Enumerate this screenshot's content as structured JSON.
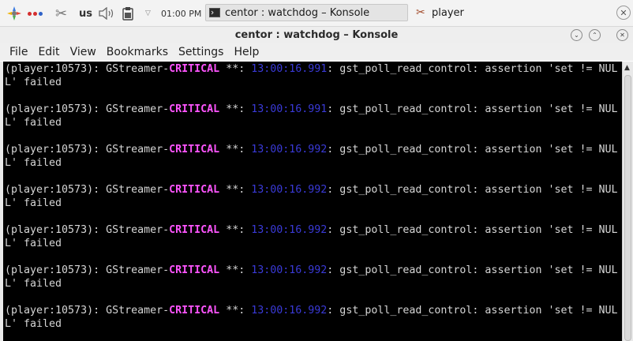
{
  "panel": {
    "layout_indicator": "us",
    "clock": "01:00 PM",
    "tasks": [
      {
        "label": "centor : watchdog – Konsole",
        "icon": "terminal-icon"
      },
      {
        "label": "player",
        "icon": "scissors-icon"
      }
    ],
    "tray_dot_colors": [
      "#d42f2f",
      "#d42f2f",
      "#2f62c8"
    ]
  },
  "window": {
    "title": "centor : watchdog – Konsole",
    "menu": [
      "File",
      "Edit",
      "View",
      "Bookmarks",
      "Settings",
      "Help"
    ]
  },
  "terminal": {
    "colors": {
      "background": "#000000",
      "text": "#d6d6d6",
      "critical": "#ff55ff",
      "timestamp": "#3a3ad8"
    },
    "entries": [
      {
        "prefix": "(player:10573): GStreamer-",
        "level": "CRITICAL",
        "sep": " **: ",
        "time": "13:00:16.991",
        "message": ": gst_poll_read_control: assertion 'set != NUL",
        "wrap": "L' failed"
      },
      {
        "prefix": "(player:10573): GStreamer-",
        "level": "CRITICAL",
        "sep": " **: ",
        "time": "13:00:16.991",
        "message": ": gst_poll_read_control: assertion 'set != NUL",
        "wrap": "L' failed"
      },
      {
        "prefix": "(player:10573): GStreamer-",
        "level": "CRITICAL",
        "sep": " **: ",
        "time": "13:00:16.992",
        "message": ": gst_poll_read_control: assertion 'set != NUL",
        "wrap": "L' failed"
      },
      {
        "prefix": "(player:10573): GStreamer-",
        "level": "CRITICAL",
        "sep": " **: ",
        "time": "13:00:16.992",
        "message": ": gst_poll_read_control: assertion 'set != NUL",
        "wrap": "L' failed"
      },
      {
        "prefix": "(player:10573): GStreamer-",
        "level": "CRITICAL",
        "sep": " **: ",
        "time": "13:00:16.992",
        "message": ": gst_poll_read_control: assertion 'set != NUL",
        "wrap": "L' failed"
      },
      {
        "prefix": "(player:10573): GStreamer-",
        "level": "CRITICAL",
        "sep": " **: ",
        "time": "13:00:16.992",
        "message": ": gst_poll_read_control: assertion 'set != NUL",
        "wrap": "L' failed"
      },
      {
        "prefix": "(player:10573): GStreamer-",
        "level": "CRITICAL",
        "sep": " **: ",
        "time": "13:00:16.992",
        "message": ": gst_poll_read_control: assertion 'set != NUL",
        "wrap": "L' failed"
      }
    ]
  }
}
